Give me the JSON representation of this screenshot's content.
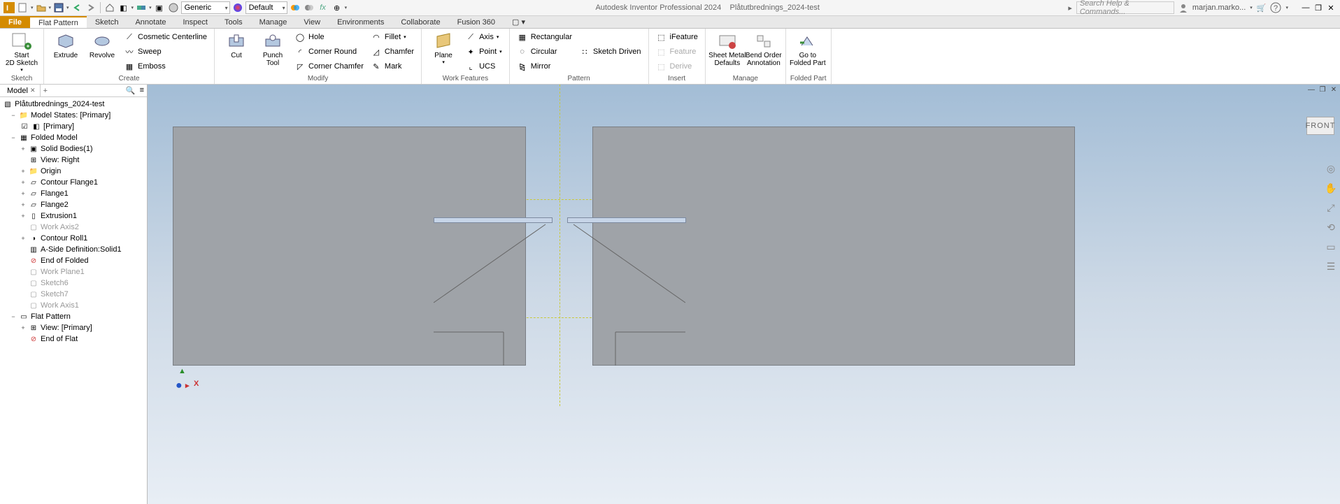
{
  "title": {
    "app": "Autodesk Inventor Professional 2024",
    "doc": "Plåtutbrednings_2024-test"
  },
  "qat": {
    "material_combo": "Generic",
    "appearance_combo": "Default"
  },
  "search_placeholder": "Search Help & Commands...",
  "user": "marjan.marko...",
  "tabs": {
    "file": "File",
    "items": [
      "Flat Pattern",
      "Sketch",
      "Annotate",
      "Inspect",
      "Tools",
      "Manage",
      "View",
      "Environments",
      "Collaborate",
      "Fusion 360"
    ]
  },
  "ribbon": {
    "sketch": {
      "start": "Start\n2D Sketch",
      "label": "Sketch"
    },
    "create": {
      "extrude": "Extrude",
      "revolve": "Revolve",
      "cosmetic": "Cosmetic Centerline",
      "sweep": "Sweep",
      "emboss": "Emboss",
      "label": "Create"
    },
    "modify": {
      "cut": "Cut",
      "punch": "Punch\nTool",
      "hole": "Hole",
      "corner_round": "Corner Round",
      "corner_chamfer": "Corner Chamfer",
      "fillet": "Fillet",
      "chamfer": "Chamfer",
      "mark": "Mark",
      "label": "Modify"
    },
    "work": {
      "plane": "Plane",
      "axis": "Axis",
      "point": "Point",
      "ucs": "UCS",
      "label": "Work Features"
    },
    "pattern": {
      "rect": "Rectangular",
      "circ": "Circular",
      "mirror": "Mirror",
      "sketch": "Sketch Driven",
      "label": "Pattern"
    },
    "insert": {
      "ifeature": "iFeature",
      "feature": "Feature",
      "derive": "Derive",
      "label": "Insert"
    },
    "manage": {
      "smd": "Sheet Metal\nDefaults",
      "bend": "Bend Order\nAnnotation",
      "label": "Manage"
    },
    "folded": {
      "go": "Go to\nFolded Part",
      "label": "Folded Part"
    }
  },
  "browser": {
    "tab": "Model",
    "root": "Plåtutbrednings_2024-test",
    "model_states": "Model States: [Primary]",
    "primary": "[Primary]",
    "folded_model": "Folded Model",
    "items": [
      "Solid Bodies(1)",
      "View: Right",
      "Origin",
      "Contour Flange1",
      "Flange1",
      "Flange2",
      "Extrusion1",
      "Work Axis2",
      "Contour Roll1",
      "A-Side Definition:Solid1",
      "End of Folded",
      "Work Plane1",
      "Sketch6",
      "Sketch7",
      "Work Axis1"
    ],
    "flat_pattern": "Flat Pattern",
    "view_primary": "View: [Primary]",
    "end_flat": "End of Flat"
  },
  "viewcube": "FRONT",
  "triad": {
    "x": "X",
    "y": "Y"
  }
}
